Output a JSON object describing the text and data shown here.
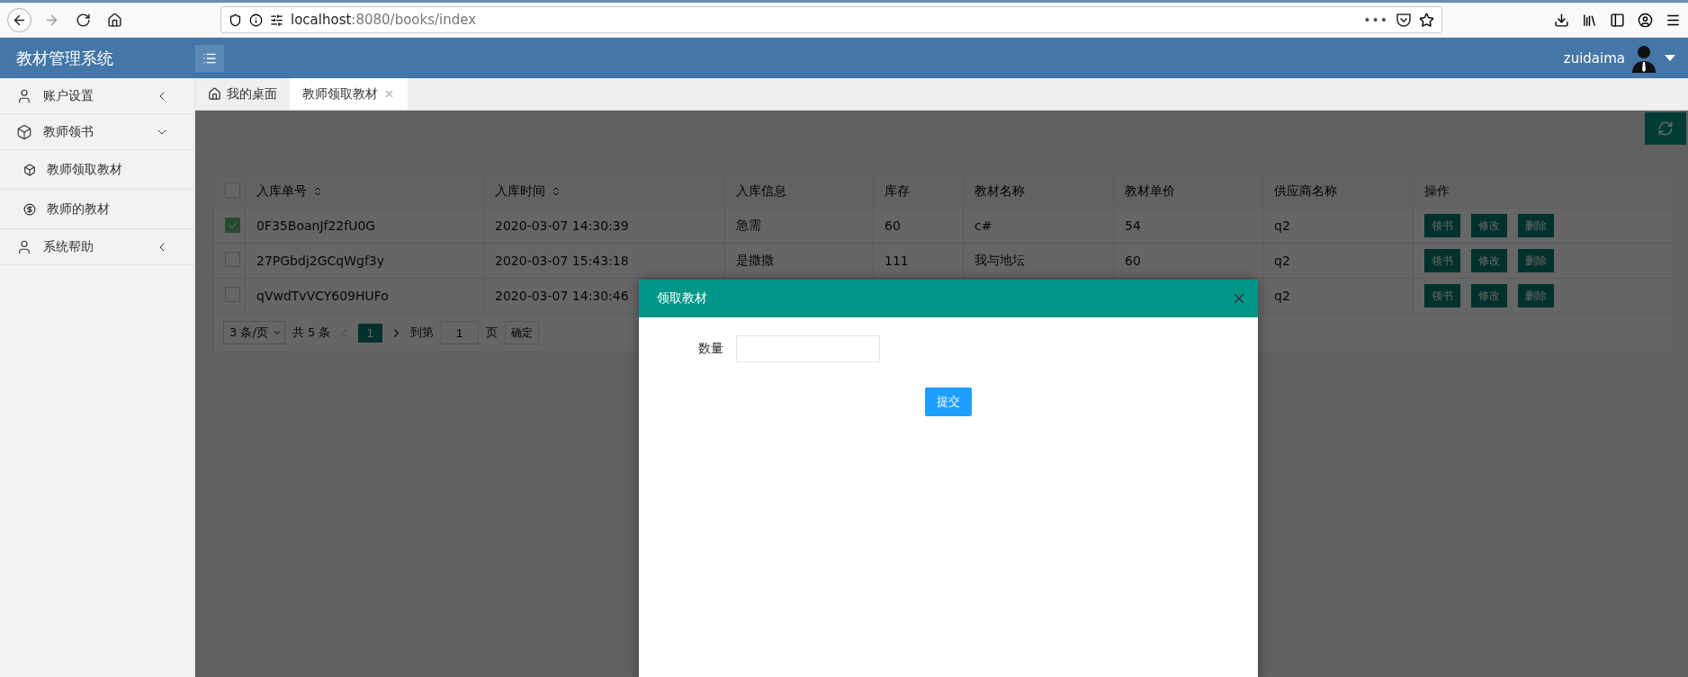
{
  "browser": {
    "url_host": "localhost",
    "url_path": ":8080/books/index",
    "more": "•••"
  },
  "header": {
    "title": "教材管理系统",
    "user": "zuidaima"
  },
  "sidebar": {
    "items": [
      {
        "label": "账户设置",
        "expanded": false
      },
      {
        "label": "教师领书",
        "expanded": true,
        "children": [
          {
            "label": "教师领取教材"
          },
          {
            "label": "教师的教材"
          }
        ]
      },
      {
        "label": "系统帮助",
        "expanded": false
      }
    ]
  },
  "tabs": [
    {
      "label": "我的桌面",
      "selected": false,
      "closable": false
    },
    {
      "label": "教师领取教材",
      "selected": true,
      "closable": true
    }
  ],
  "table": {
    "all_checked": false,
    "columns": [
      {
        "label": "入库单号",
        "sortable": true
      },
      {
        "label": "入库时间",
        "sortable": true
      },
      {
        "label": "入库信息",
        "sortable": false
      },
      {
        "label": "库存",
        "sortable": false
      },
      {
        "label": "教材名称",
        "sortable": false
      },
      {
        "label": "教材单价",
        "sortable": false
      },
      {
        "label": "供应商名称",
        "sortable": false
      },
      {
        "label": "操作",
        "sortable": false
      }
    ],
    "rows": [
      {
        "checked": true,
        "cells": [
          "0F35BoanJf22fU0G",
          "2020-03-07 14:30:39",
          "急需",
          "60",
          "c#",
          "54",
          "q2"
        ],
        "actions": [
          "领书",
          "修改",
          "删除"
        ]
      },
      {
        "checked": false,
        "cells": [
          "27PGbdj2GCqWgf3y",
          "2020-03-07 15:43:18",
          "是撒撒",
          "111",
          "我与地坛",
          "60",
          "q2"
        ],
        "actions": [
          "领书",
          "修改",
          "删除"
        ]
      },
      {
        "checked": false,
        "cells": [
          "qVwdTvVCY609HUFo",
          "2020-03-07 14:30:46",
          null,
          null,
          null,
          null,
          "q2"
        ],
        "actions": [
          "领书",
          "修改",
          "删除"
        ]
      }
    ]
  },
  "pagination": {
    "page_size": "3 条/页",
    "total": "共 5 条",
    "pages": [
      {
        "label": "1",
        "selected": true
      }
    ],
    "goto_label": "到第",
    "goto_value": "1",
    "goto_unit": "页",
    "confirm": "确定"
  },
  "modal": {
    "title": "领取教材",
    "field_label": "数量",
    "submit": "提交"
  }
}
